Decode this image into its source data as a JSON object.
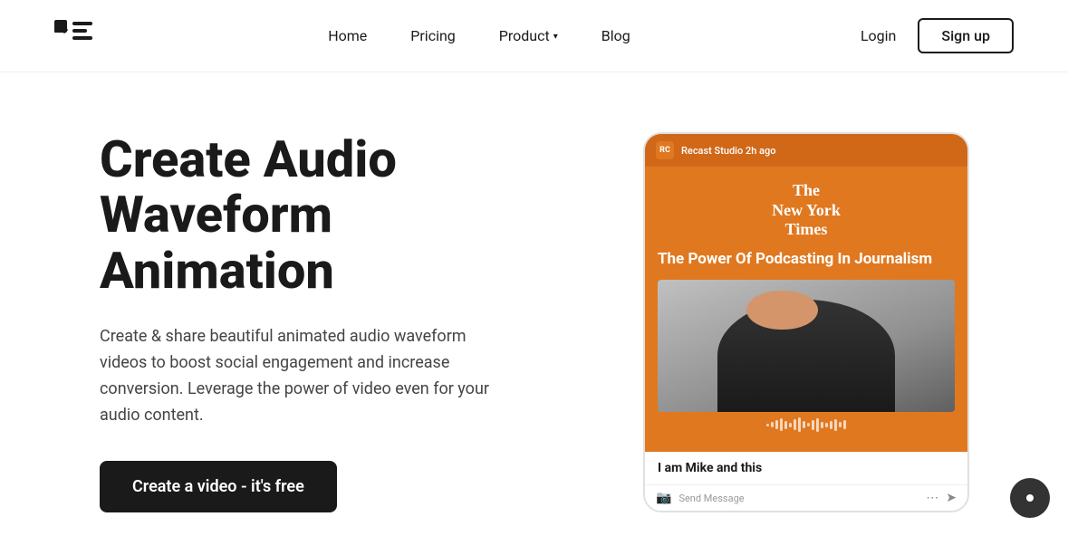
{
  "header": {
    "logo_alt": "Recast Studio Logo",
    "nav": {
      "home": "Home",
      "pricing": "Pricing",
      "product": "Product",
      "product_has_dropdown": true,
      "blog": "Blog"
    },
    "auth": {
      "login": "Login",
      "signup": "Sign up"
    }
  },
  "hero": {
    "title": "Create Audio Waveform Animation",
    "description": "Create & share beautiful animated audio waveform videos to boost social engagement and increase conversion. Leverage the power of video even for your audio content.",
    "cta": "Create a video - it's free"
  },
  "demo_card": {
    "story_header_icon": "RC",
    "story_header_text": "Recast Studio 2h ago",
    "nyt_line1": "The",
    "nyt_line2": "New York",
    "nyt_line3": "Times",
    "story_title": "The Power Of Podcasting In Journalism",
    "caption_text": "I am Mike and this",
    "ig_placeholder": "Send Message",
    "waveform_bars": [
      3,
      6,
      10,
      14,
      9,
      5,
      12,
      16,
      8,
      4,
      11,
      15,
      7,
      5,
      9,
      13,
      6,
      10
    ]
  },
  "chat_widget": {
    "icon": "·"
  }
}
